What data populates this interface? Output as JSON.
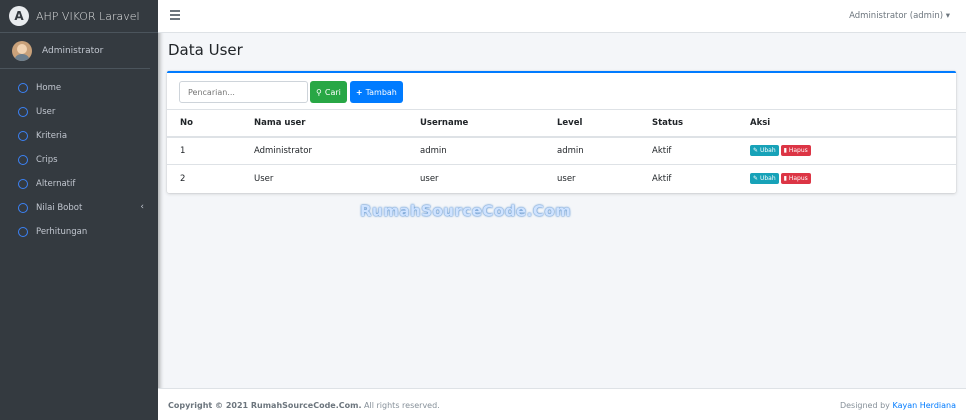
{
  "brand": {
    "logo_letter": "A",
    "title": "AHP VIKOR Laravel"
  },
  "user_panel": {
    "name": "Administrator"
  },
  "sidebar": {
    "items": [
      {
        "label": "Home"
      },
      {
        "label": "User"
      },
      {
        "label": "Kriteria"
      },
      {
        "label": "Crips"
      },
      {
        "label": "Alternatif"
      },
      {
        "label": "Nilai Bobot",
        "chevron": "‹"
      },
      {
        "label": "Perhitungan"
      }
    ]
  },
  "topbar": {
    "user_menu": "Administrator (admin) ▾"
  },
  "page": {
    "title": "Data User"
  },
  "toolbar": {
    "search_placeholder": "Pencarian...",
    "search_button": "Cari",
    "add_button": "Tambah"
  },
  "table": {
    "headers": [
      "No",
      "Nama user",
      "Username",
      "Level",
      "Status",
      "Aksi"
    ],
    "rows": [
      {
        "no": "1",
        "name": "Administrator",
        "username": "admin",
        "level": "admin",
        "status": "Aktif"
      },
      {
        "no": "2",
        "name": "User",
        "username": "user",
        "level": "user",
        "status": "Aktif"
      }
    ],
    "edit_label": "Ubah",
    "delete_label": "Hapus"
  },
  "watermark": "RumahSourceCode.Com",
  "footer": {
    "copyright": "Copyright © 2021 RumahSourceCode.Com.",
    "rights": " All rights reserved.",
    "designed_by": "Designed by ",
    "designer": "Kayan Herdiana"
  },
  "colors": {
    "sidebar": "#343a40",
    "accent": "#007bff",
    "success": "#28a745",
    "danger": "#dc3545",
    "info": "#17a2b8"
  }
}
